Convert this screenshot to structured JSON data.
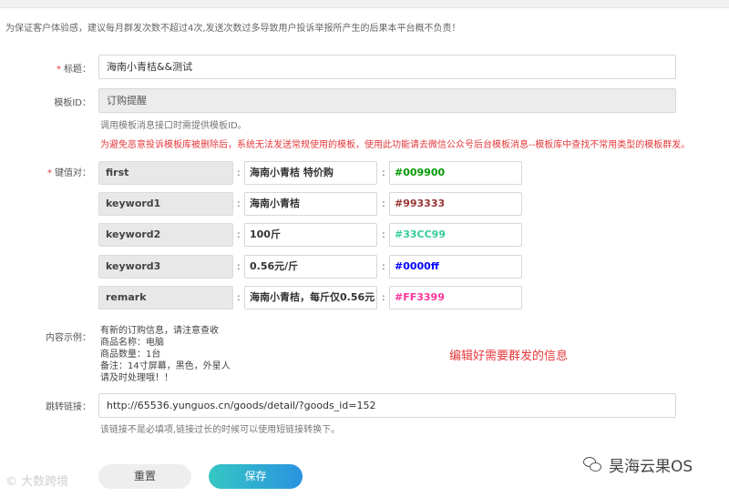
{
  "notice": "为保证客户体验感，建议每月群发次数不超过4次,发送次数过多导致用户投诉举报所产生的后果本平台概不负责！",
  "form": {
    "title_label": "标题：",
    "title_value": "海南小青桔&&测试",
    "template_id_label": "模板ID：",
    "template_id_value": "订购提醒",
    "template_id_hint": "调用模板消息接口时需提供模板ID。",
    "template_warning": "为避免恶意投诉模板库被删除后，系统无法发送常规使用的模板，使用此功能请去微信公众号后台模板消息--模板库中查找不常用类型的模板群发。",
    "kv_label": "键值对：",
    "kv_pairs": [
      {
        "key": "first",
        "value": "海南小青桔 特价购",
        "color": "#009900"
      },
      {
        "key": "keyword1",
        "value": "海南小青桔",
        "color": "#993333"
      },
      {
        "key": "keyword2",
        "value": "100斤",
        "color": "#33CC99"
      },
      {
        "key": "keyword3",
        "value": "0.56元/斤",
        "color": "#0000ff"
      },
      {
        "key": "remark",
        "value": "海南小青桔，每斤仅0.56元",
        "color": "#FF3399"
      }
    ],
    "example_label": "内容示例：",
    "example_lines": [
      "有新的订购信息，请注意查收",
      "商品名称：电脑",
      "商品数量：1台",
      "备注：14寸屏幕，黑色，外星人",
      "请及时处理哦！！"
    ],
    "annotation": "编辑好需要群发的信息",
    "link_label": "跳转链接：",
    "link_value": "http://65536.yunguos.cn/goods/detail/?goods_id=152",
    "link_hint": "该链接不是必填项,链接过长的时候可以使用短链接转换下。",
    "reset_label": "重置",
    "save_label": "保存"
  },
  "watermarks": {
    "left": "大数跨境",
    "right": "昊海云果OS"
  },
  "colors": {
    "required": "#e4393c",
    "warning": "#e4393c",
    "save_gradient_start": "#36c7c4",
    "save_gradient_end": "#2a93e0"
  }
}
